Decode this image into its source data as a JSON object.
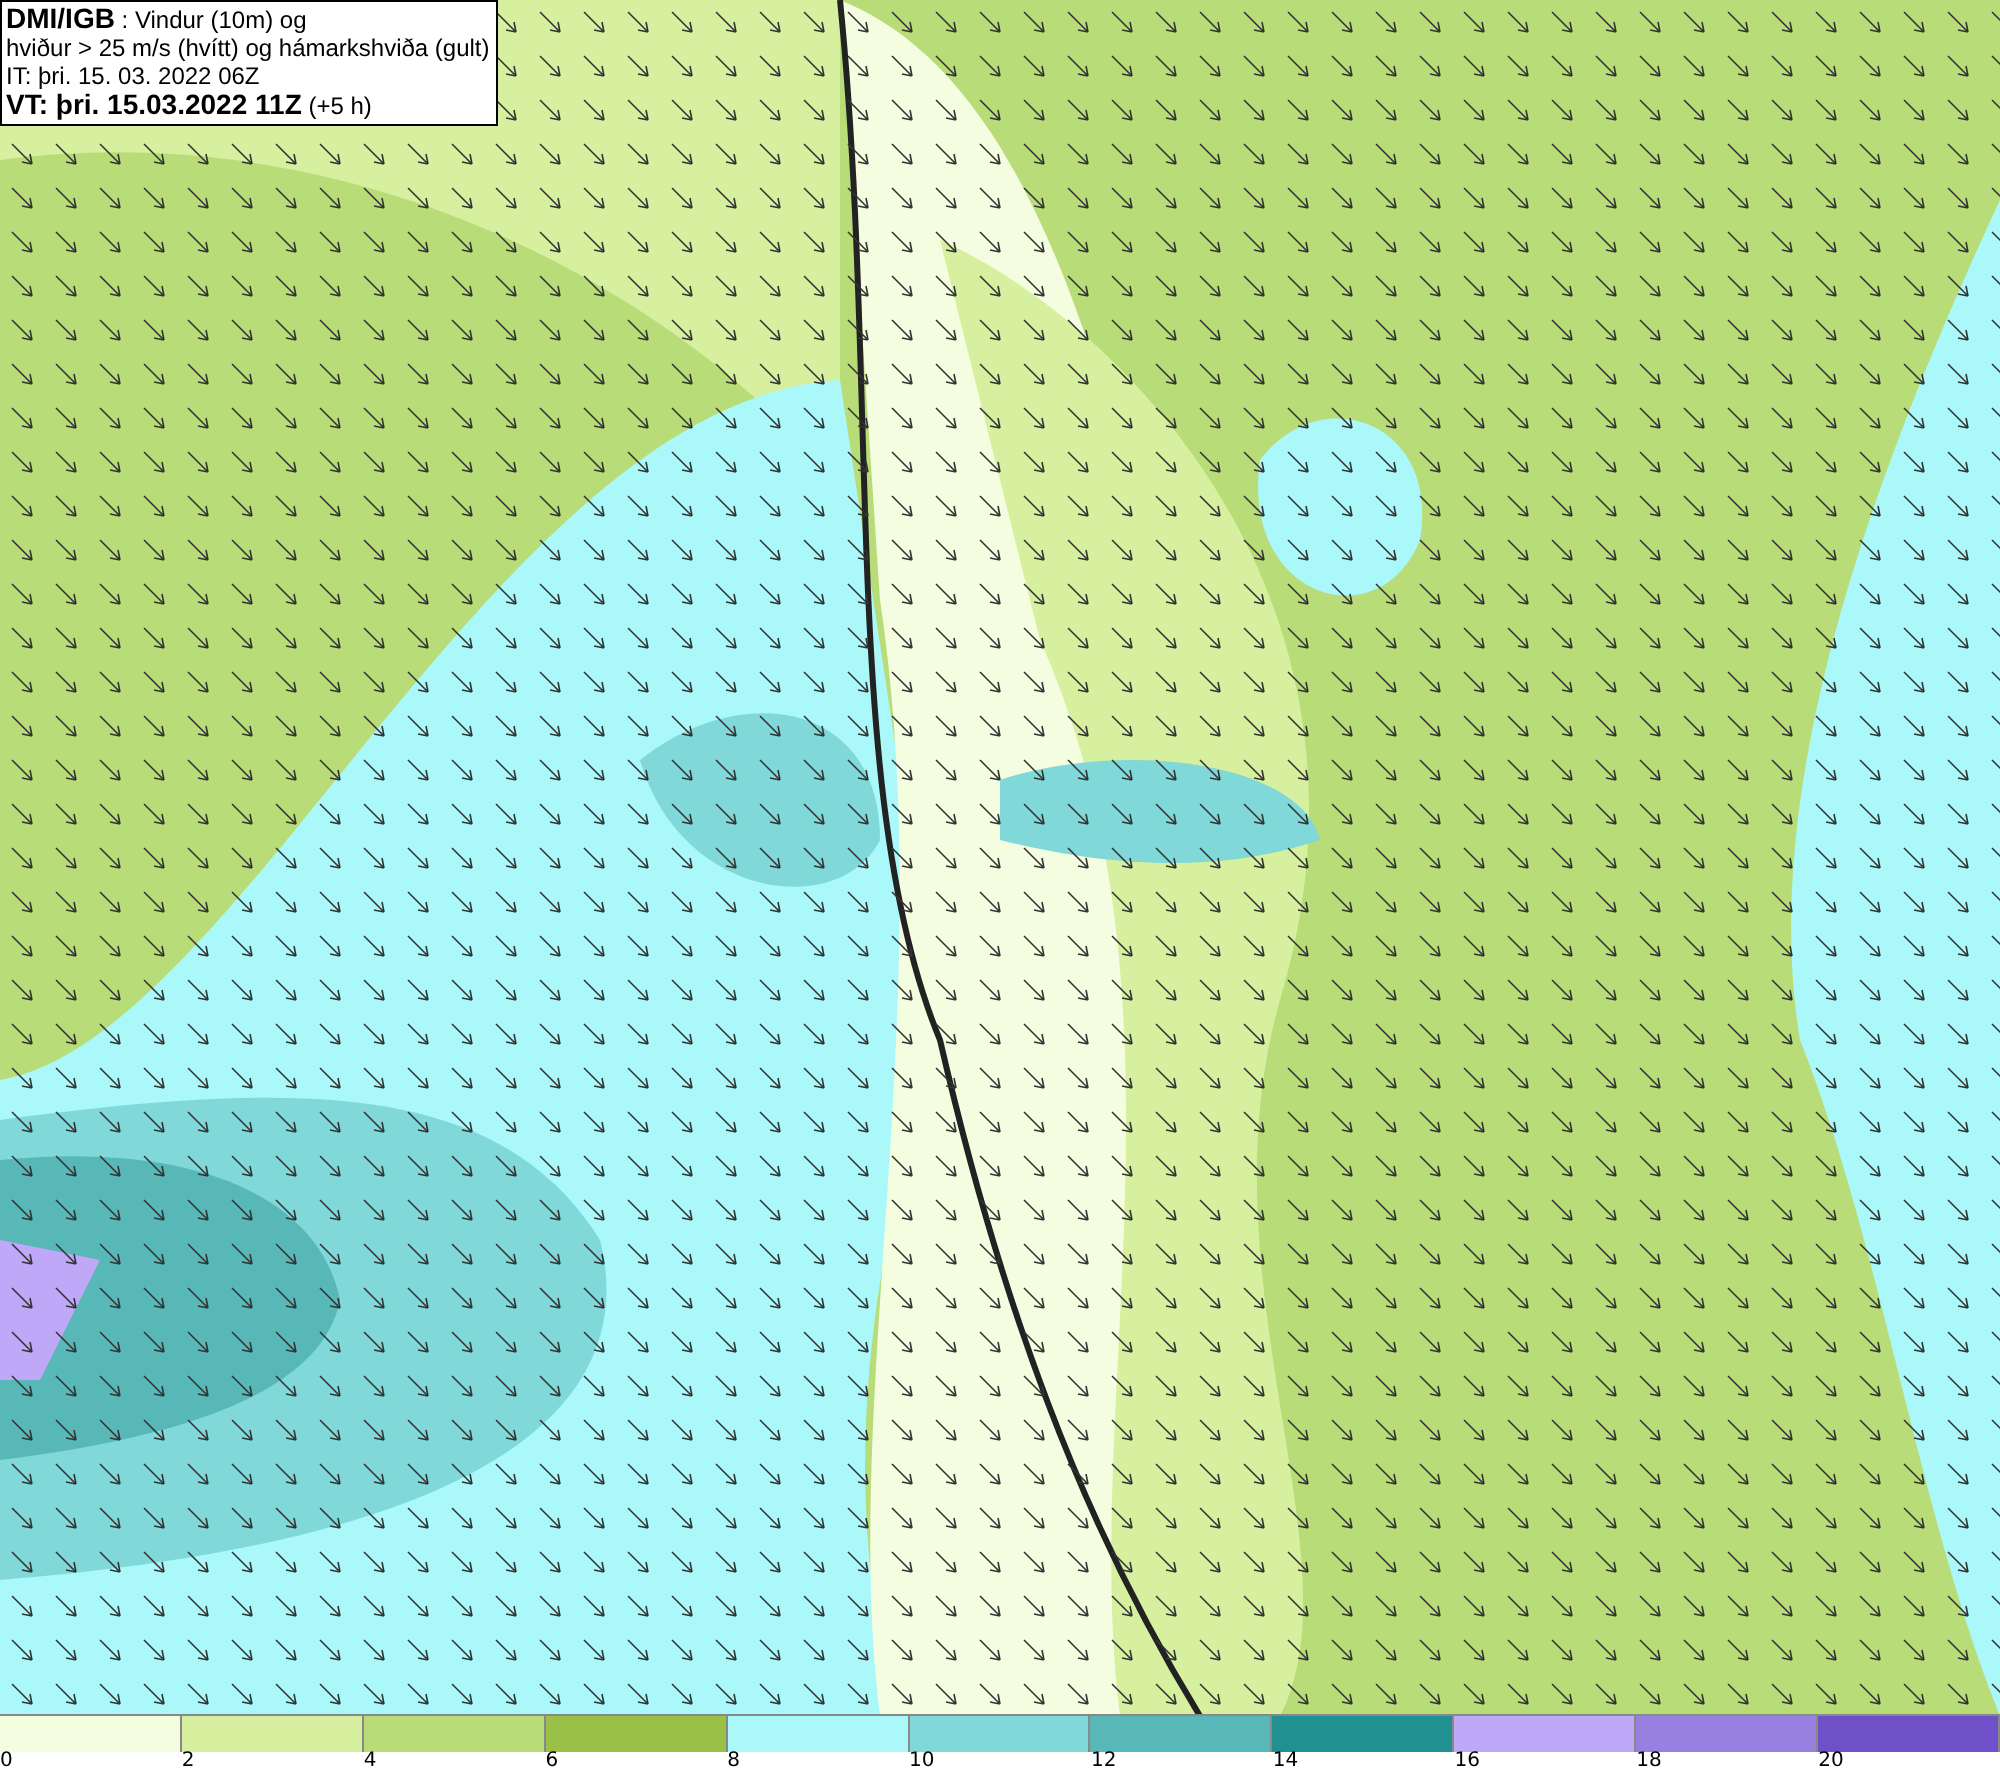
{
  "header": {
    "lines": [
      "**DMI/IGB** : Vindur (10m) og",
      "hviður > 25 m/s (hvítt) og hámarkshviða (gult)",
      "IT: þri. 15. 03. 2022 06Z",
      "**VT: þri. 15.03.2022 11Z** (+5 h)"
    ]
  },
  "legend": {
    "bins": [
      {
        "label": "0",
        "color": "#f5fde0"
      },
      {
        "label": "2",
        "color": "#d6f0a0"
      },
      {
        "label": "4",
        "color": "#b8dc78"
      },
      {
        "label": "6",
        "color": "#9bc048"
      },
      {
        "label": "8",
        "color": "#aaf8fa"
      },
      {
        "label": "10",
        "color": "#80d8d8"
      },
      {
        "label": "12",
        "color": "#58b8b8"
      },
      {
        "label": "14",
        "color": "#209090"
      },
      {
        "label": "16",
        "color": "#c0a8f8"
      },
      {
        "label": "18",
        "color": "#9880e0"
      },
      {
        "label": "20",
        "color": "#7050c8"
      }
    ]
  }
}
